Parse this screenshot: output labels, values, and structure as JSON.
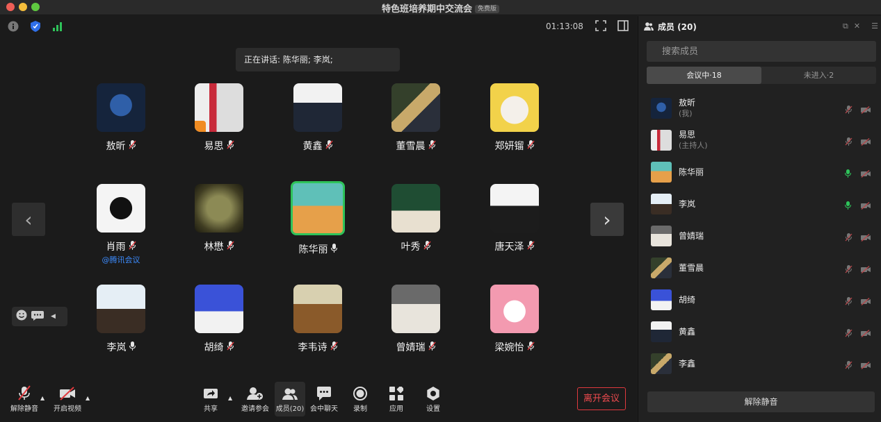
{
  "window": {
    "title": "特色班培养期中交流会",
    "badge": "免费版"
  },
  "meeting": {
    "clock": "01:13:08",
    "speaking": "正在讲话: 陈华丽; 李岚;"
  },
  "grid": [
    {
      "name": "敖昕",
      "mic": "muted"
    },
    {
      "name": "易思",
      "mic": "muted",
      "host_badge": true
    },
    {
      "name": "黄鑫",
      "mic": "muted"
    },
    {
      "name": "董雪晨",
      "mic": "muted"
    },
    {
      "name": "郑妍镏",
      "mic": "muted"
    },
    {
      "name": "肖雨",
      "mic": "muted",
      "sub": "@腾讯会议"
    },
    {
      "name": "林懋",
      "mic": "muted"
    },
    {
      "name": "陈华丽",
      "mic": "on",
      "active": true
    },
    {
      "name": "叶秀",
      "mic": "muted"
    },
    {
      "name": "唐天泽",
      "mic": "muted"
    },
    {
      "name": "李岚",
      "mic": "on"
    },
    {
      "name": "胡绮",
      "mic": "muted"
    },
    {
      "name": "李韦诗",
      "mic": "muted"
    },
    {
      "name": "曾婧瑞",
      "mic": "muted"
    },
    {
      "name": "梁婉怡",
      "mic": "muted"
    }
  ],
  "toolbar": {
    "unmute": "解除静音",
    "start_video": "开启视频",
    "share": "共享",
    "invite": "邀请参会",
    "members": "成员(20)",
    "chat": "会中聊天",
    "record": "录制",
    "apps": "应用",
    "settings": "设置",
    "leave": "离开会议"
  },
  "sidebar": {
    "title": "成员 (20)",
    "search_placeholder": "搜索成员",
    "tab_in": "会议中·18",
    "tab_out": "未进入·2",
    "members": [
      {
        "name": "敖昕",
        "role": "(我)",
        "mic": "muted"
      },
      {
        "name": "易思",
        "role": "(主持人)",
        "mic": "muted"
      },
      {
        "name": "陈华丽",
        "role": "",
        "mic": "on"
      },
      {
        "name": "李岚",
        "role": "",
        "mic": "on"
      },
      {
        "name": "曾婧瑞",
        "role": "",
        "mic": "muted"
      },
      {
        "name": "董雪晨",
        "role": "",
        "mic": "muted"
      },
      {
        "name": "胡绮",
        "role": "",
        "mic": "muted"
      },
      {
        "name": "黄鑫",
        "role": "",
        "mic": "muted"
      },
      {
        "name": "李鑫",
        "role": "",
        "mic": "muted"
      }
    ],
    "unmute_all": "解除静音"
  },
  "colors": {
    "accent_green": "#2ec35a",
    "leave_red": "#e0393e",
    "link_blue": "#3c8cff"
  }
}
